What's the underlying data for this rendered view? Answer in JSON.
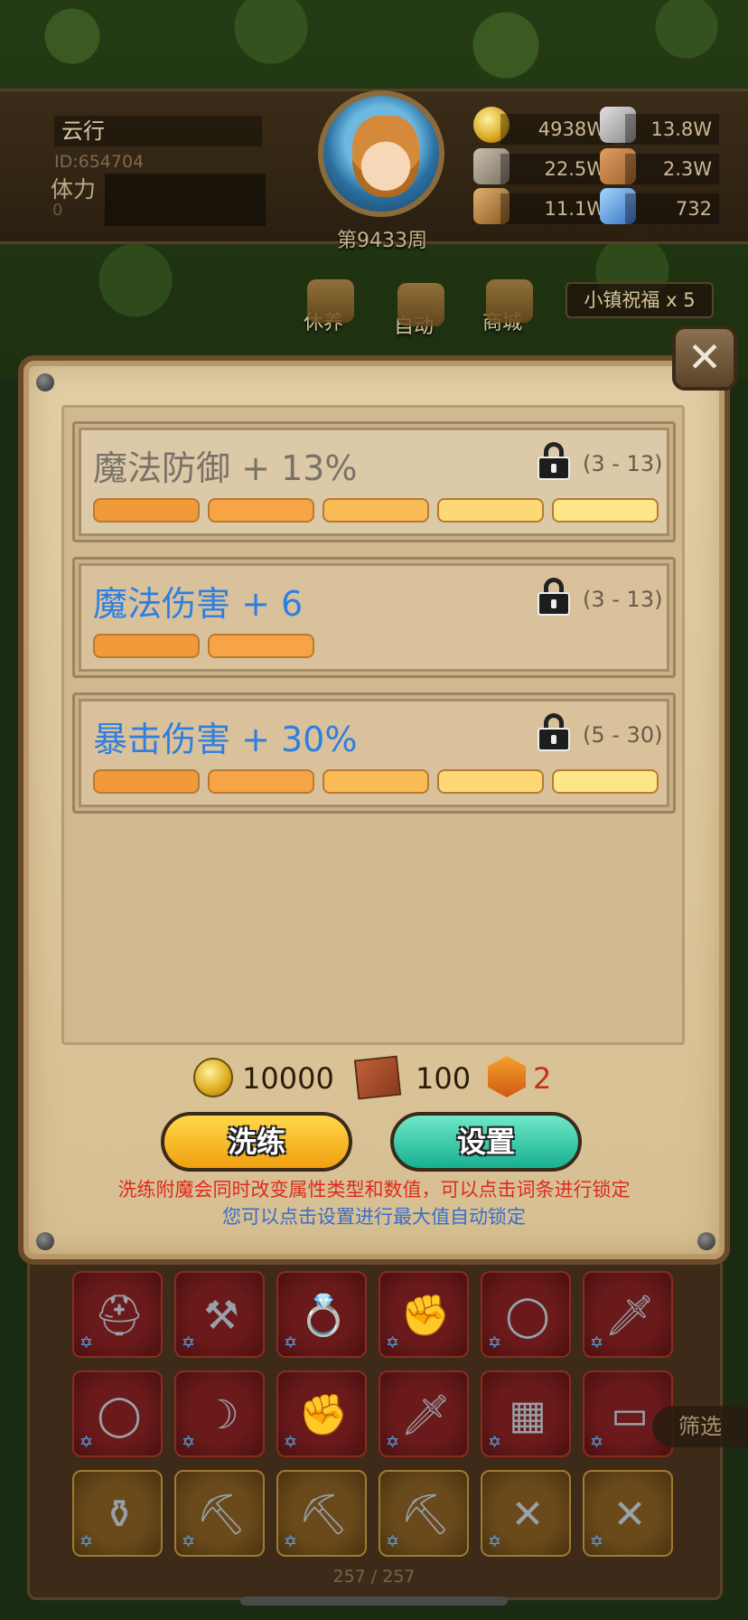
{
  "player": {
    "name": "云行",
    "id": "ID:654704",
    "stamina_label": "体力",
    "stamina_value": "0",
    "stamina_icons": "⚡⚡⚡⚡⚡ ⚡⚡⚡⚡⚡",
    "week": "第9433周"
  },
  "resources": [
    {
      "icon": "gold-coin-icon",
      "value": "4938W"
    },
    {
      "icon": "metal-ingot-icon",
      "value": "13.8W"
    },
    {
      "icon": "stone-icon",
      "value": "22.5W"
    },
    {
      "icon": "leather-icon",
      "value": "2.3W"
    },
    {
      "icon": "wood-log-icon",
      "value": "11.1W"
    },
    {
      "icon": "crystal-icon",
      "value": "732"
    }
  ],
  "menu": {
    "rest": "休养",
    "auto": "自动",
    "shop": "商城",
    "blessing": "小镇祝福 x 5"
  },
  "dialog": {
    "attributes": [
      {
        "name": "魔法防御 + 13%",
        "range": "(3 - 13)",
        "color": "#7a7268",
        "bars": [
          "#f09a3a",
          "#f6a445",
          "#f8bb55",
          "#fcd877",
          "#fde58a"
        ]
      },
      {
        "name": "魔法伤害 + 6",
        "range": "(3 - 13)",
        "color": "#2f7fe0",
        "bars": [
          "#f09a3a",
          "#f6a445"
        ]
      },
      {
        "name": "暴击伤害 + 30%",
        "range": "(5 - 30)",
        "color": "#2f7fe0",
        "bars": [
          "#f09a3a",
          "#f6a445",
          "#f8bb55",
          "#fcd877",
          "#fde58a"
        ]
      }
    ],
    "costs": {
      "gold": "10000",
      "scroll": "100",
      "gem": "2"
    },
    "refine_label": "洗练",
    "settings_label": "设置",
    "hint_red": "洗练附魔会同时改变属性类型和数值，可以点击词条进行锁定",
    "hint_blue": "您可以点击设置进行最大值自动锁定",
    "close_icon": "crossed-swords-icon"
  },
  "inventory": {
    "filter_label": "筛选",
    "page_count": "257 / 257",
    "items": [
      "helmet-icon",
      "axe-icon",
      "gem-ring-icon",
      "gauntlet-icon",
      "ring-icon",
      "dagger-icon",
      "ring-icon",
      "scythe-icon",
      "gauntlet-icon",
      "dagger-icon",
      "spellbook-icon",
      "bracer-icon",
      "lantern-icon",
      "pickaxe-icon",
      "pickaxe-icon",
      "pickaxe-icon",
      "crossed-blades-icon",
      "crossed-blades-icon"
    ]
  }
}
